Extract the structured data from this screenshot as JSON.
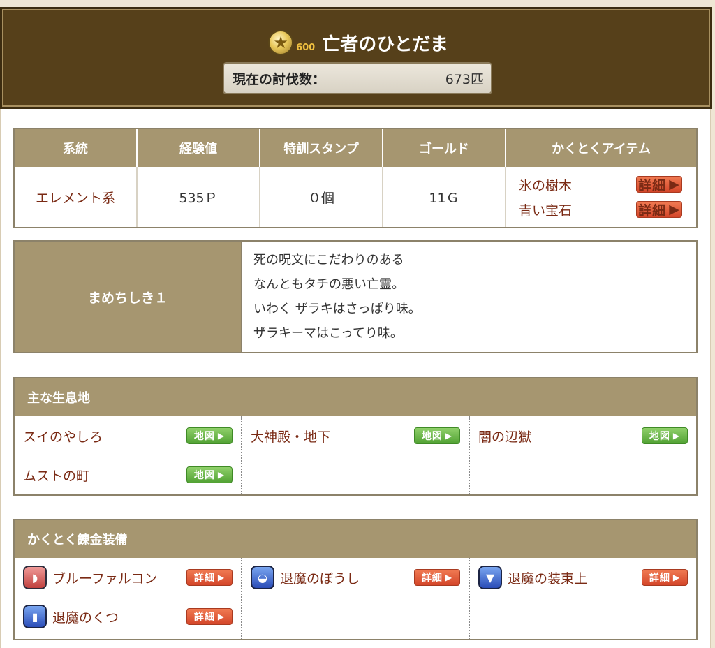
{
  "header": {
    "points": "600",
    "monster_name": "亡者のひとだま",
    "kill_label": "現在の討伐数：",
    "kill_value": "673匹"
  },
  "stats": {
    "headers": [
      "系統",
      "経験値",
      "特訓スタンプ",
      "ゴールド",
      "かくとくアイテム"
    ],
    "type": "エレメント系",
    "exp": "535Ｐ",
    "stamp": "０個",
    "gold": "11Ｇ",
    "items": [
      "氷の樹木",
      "青い宝石"
    ]
  },
  "trivia": {
    "label": "まめちしき１",
    "lines": [
      "死の呪文にこだわりのある",
      "なんともタチの悪い亡霊。",
      "いわく ザラキはさっぱり味。",
      "ザラキーマはこってり味。"
    ]
  },
  "habitat": {
    "title": "主な生息地",
    "places": [
      "スイのやしろ",
      "ムストの町",
      "大神殿・地下",
      "闇の辺獄"
    ]
  },
  "equipment": {
    "title": "かくとく錬金装備",
    "items": [
      "ブルーファルコン",
      "退魔のくつ",
      "退魔のぼうし",
      "退魔の装束上"
    ]
  },
  "buttons": {
    "detail": "詳細",
    "map": "地図"
  },
  "icons": {
    "star": "star-icon",
    "arrow": "triangle-right-icon"
  }
}
